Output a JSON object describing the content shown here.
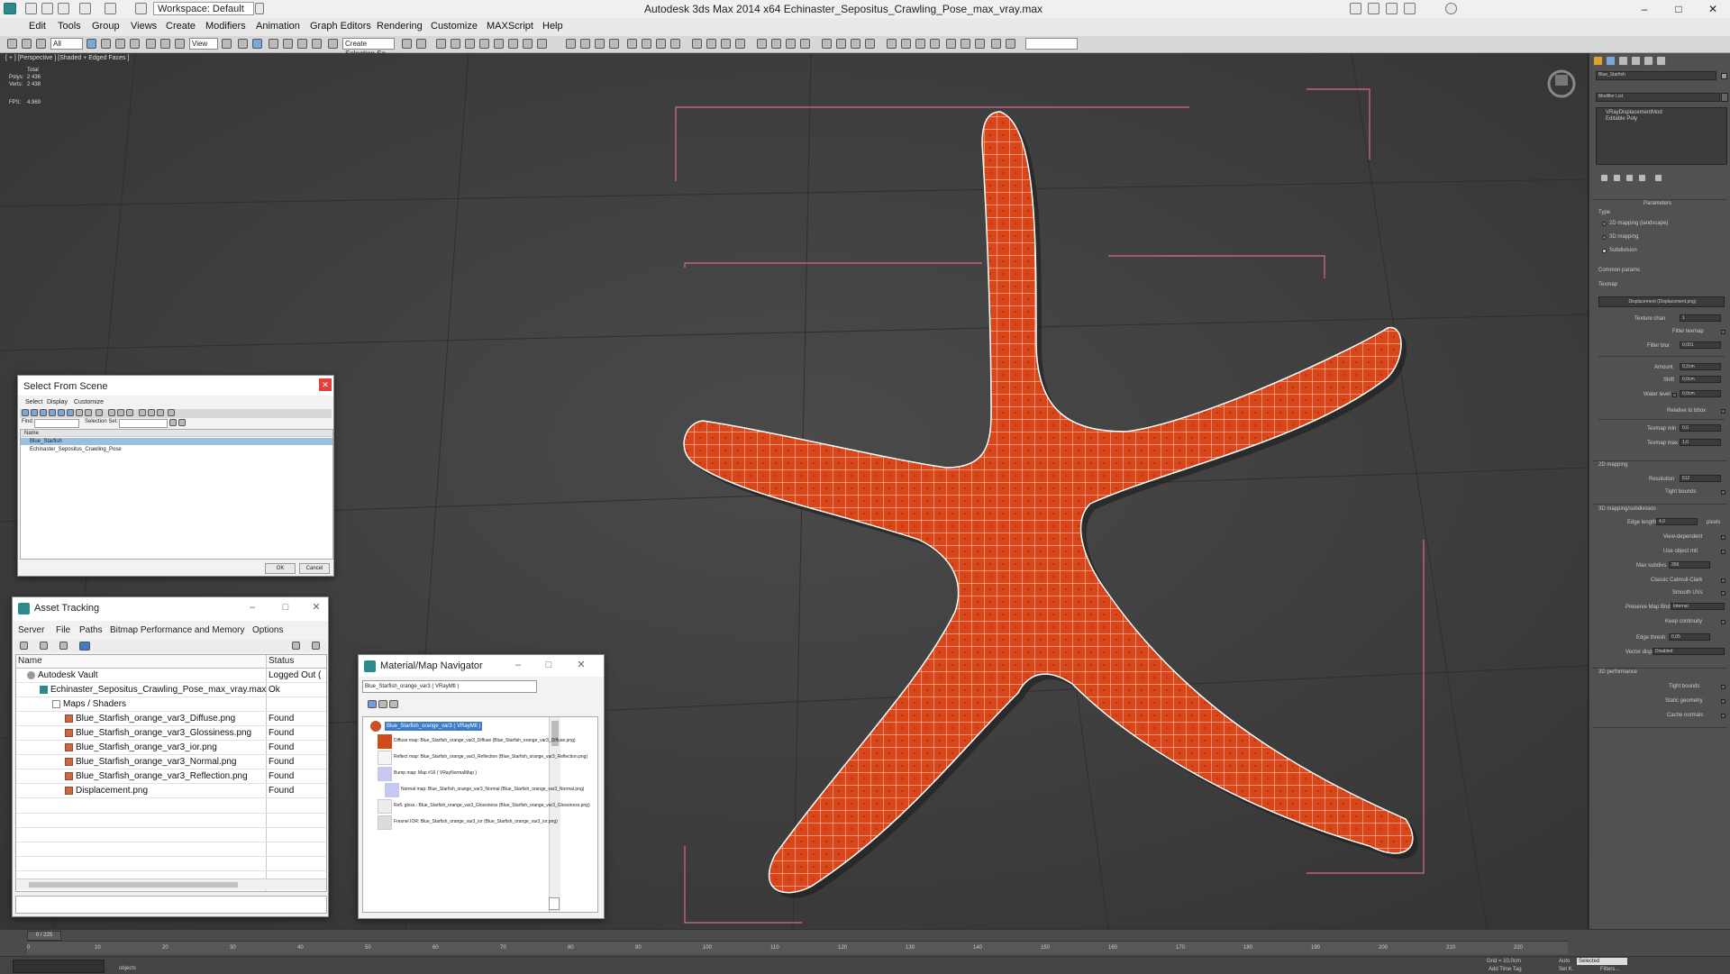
{
  "app": {
    "title": "Autodesk 3ds Max  2014 x64     Echinaster_Sepositus_Crawling_Pose_max_vray.max",
    "workspace": "Workspace: Default"
  },
  "menu": [
    "Edit",
    "Tools",
    "Group",
    "Views",
    "Create",
    "Modifiers",
    "Animation",
    "Graph Editors",
    "Rendering",
    "Customize",
    "MAXScript",
    "Help"
  ],
  "toolbar": {
    "selection_filter": "All",
    "reference_coord": "View",
    "named_selection": "Create Selection Se"
  },
  "viewport": {
    "label": "[ + ] [Perspective ] [Shaded + Edged Faces ]",
    "stats": {
      "total_label": "Total",
      "polys_label": "Polys:",
      "polys_value": "2 436",
      "verts_label": "Verts:",
      "verts_value": "2 438",
      "fps_label": "FPS:",
      "fps_value": "4.969"
    },
    "object_color": "#d9461a",
    "wire_color": "#ffffff",
    "bbox_color": "#d86a8a"
  },
  "command_panel": {
    "object_name": "Blue_Starfish",
    "modifier_list_label": "Modifier List",
    "stack": [
      "VRayDisplacementMod",
      "Editable Poly"
    ],
    "parameters_title": "Parameters",
    "type_label": "Type",
    "type_options": [
      "2D mapping (landscape)",
      "3D mapping",
      "Subdivision"
    ],
    "common_params_label": "Common params",
    "texmap_label": "Texmap",
    "texmap_button": "Displacement (Displacement.png)",
    "texture_chan_label": "Texture chan",
    "texture_chan_value": "1",
    "filter_texmap_label": "Filter texmap",
    "filter_blur_label": "Filter blur",
    "filter_blur_value": "0,001",
    "amount_label": "Amount",
    "amount_value": "0,2cm",
    "shift_label": "Shift",
    "shift_value": "0,0cm",
    "water_level_label": "Water level",
    "water_level_value": "0,0cm",
    "relative_bbox_label": "Relative to bbox",
    "texmap_min_label": "Texmap min",
    "texmap_min_value": "0,0",
    "texmap_max_label": "Texmap max",
    "texmap_max_value": "1,0",
    "mapping2d_label": "2D mapping",
    "resolution_label": "Resolution",
    "resolution_value": "512",
    "tight_bounds_label": "Tight bounds",
    "mapping3d_label": "3D mapping/subdivision",
    "edge_length_label": "Edge length",
    "edge_length_value": "4,0",
    "pixels_label": "pixels",
    "view_dependent_label": "View-dependent",
    "use_object_mtl_label": "Use object mtl",
    "max_subdivs_label": "Max subdivs",
    "max_subdivs_value": "256",
    "classic_cc_label": "Classic Catmull-Clark",
    "smooth_uvs_label": "Smooth UVs",
    "preserve_map_bnd_label": "Preserve Map Bnd",
    "preserve_map_bnd_value": "Internal",
    "keep_continuity_label": "Keep continuity",
    "edge_thresh_label": "Edge thresh",
    "edge_thresh_value": "0,05",
    "vector_disp_label": "Vector displ",
    "vector_disp_value": "Disabled",
    "perf_label": "3D performance",
    "tight_bounds2_label": "Tight bounds",
    "static_geometry_label": "Static geometry",
    "cache_normals_label": "Cache normals"
  },
  "select_from_scene": {
    "title": "Select From Scene",
    "menu": [
      "Select",
      "Display",
      "Customize"
    ],
    "find_label": "Find:",
    "selection_set_label": "Selection Set:",
    "column_name": "Name",
    "items": [
      "Blue_Starfish",
      "Echinaster_Sepositus_Crawling_Pose"
    ],
    "ok": "OK",
    "cancel": "Cancel"
  },
  "asset_tracking": {
    "title": "Asset Tracking",
    "menu": [
      "Server",
      "File",
      "Paths",
      "Bitmap Performance and Memory",
      "Options"
    ],
    "col_name": "Name",
    "col_status": "Status",
    "rows": [
      {
        "name": "Autodesk Vault",
        "status": "Logged Out (",
        "indent": 0
      },
      {
        "name": "Echinaster_Sepositus_Crawling_Pose_max_vray.max",
        "status": "Ok",
        "indent": 1
      },
      {
        "name": "Maps / Shaders",
        "status": "",
        "indent": 2
      },
      {
        "name": "Blue_Starfish_orange_var3_Diffuse.png",
        "status": "Found",
        "indent": 3
      },
      {
        "name": "Blue_Starfish_orange_var3_Glossiness.png",
        "status": "Found",
        "indent": 3
      },
      {
        "name": "Blue_Starfish_orange_var3_ior.png",
        "status": "Found",
        "indent": 3
      },
      {
        "name": "Blue_Starfish_orange_var3_Normal.png",
        "status": "Found",
        "indent": 3
      },
      {
        "name": "Blue_Starfish_orange_var3_Reflection.png",
        "status": "Found",
        "indent": 3
      },
      {
        "name": "Displacement.png",
        "status": "Found",
        "indent": 3
      }
    ]
  },
  "material_navigator": {
    "title": "Material/Map Navigator",
    "field": "Blue_Starfish_orange_var3  ( VRayMtl )",
    "items": [
      "Blue_Starfish_orange_var3  ( VRayMtl )",
      "Diffuse map: Blue_Starfish_orange_var3_Diffuse (Blue_Starfish_orange_var3_Diffuse.png)",
      "Reflect map: Blue_Starfish_orange_var3_Reflection (Blue_Starfish_orange_var3_Reflection.png)",
      "Bump map: Map #16  ( VRayNormalMap )",
      "Normal map: Blue_Starfish_orange_var3_Normal (Blue_Starfish_orange_var3_Normal.png)",
      "Refl. gloss.: Blue_Starfish_orange_var3_Glossiness (Blue_Starfish_orange_var3_Glossiness.png)",
      "Fresnel IOR: Blue_Starfish_orange_var3_ior (Blue_Starfish_orange_var3_ior.png)"
    ]
  },
  "timeline": {
    "frame_counter": "0 / 225",
    "ticks": [
      "0",
      "10",
      "20",
      "30",
      "40",
      "50",
      "60",
      "70",
      "80",
      "90",
      "100",
      "110",
      "120",
      "130",
      "140",
      "150",
      "160",
      "170",
      "180",
      "190",
      "200",
      "210",
      "220"
    ]
  },
  "status": {
    "objects": "objects",
    "grid": "Grid = 10,0cm",
    "add_time_tag": "Add Time Tag",
    "auto": "Auto",
    "selected": "Selected",
    "set_k": "Set K.",
    "filters": "Filters..."
  }
}
